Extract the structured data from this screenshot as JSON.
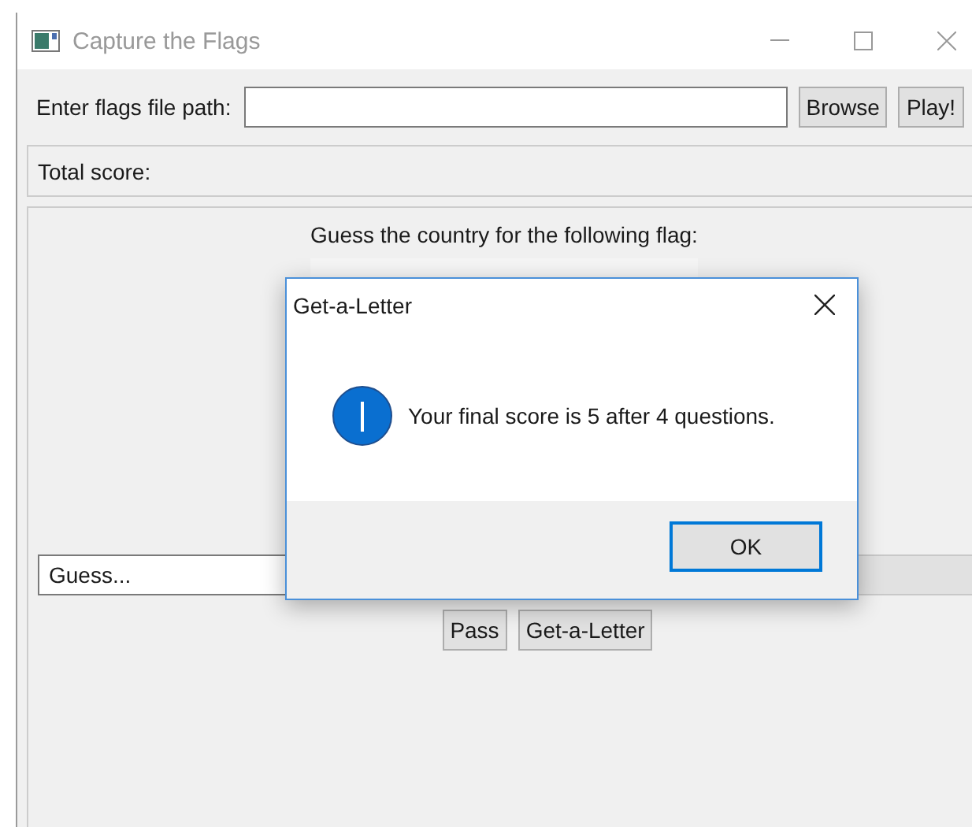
{
  "window": {
    "title": "Capture the Flags"
  },
  "path_row": {
    "label": "Enter flags file path:",
    "buttons": [
      "Browse",
      "Play!"
    ]
  },
  "score": {
    "label": "Total score:"
  },
  "question": {
    "prompt": "Guess the country for the following flag:",
    "guess": {
      "placeholder": "Guess..."
    },
    "buttons": [
      "Pass",
      "Get-a-Letter"
    ]
  },
  "dialog": {
    "title": "Get-a-Letter",
    "message": "Your final score is 5 after 4 questions.",
    "button": "OK"
  }
}
